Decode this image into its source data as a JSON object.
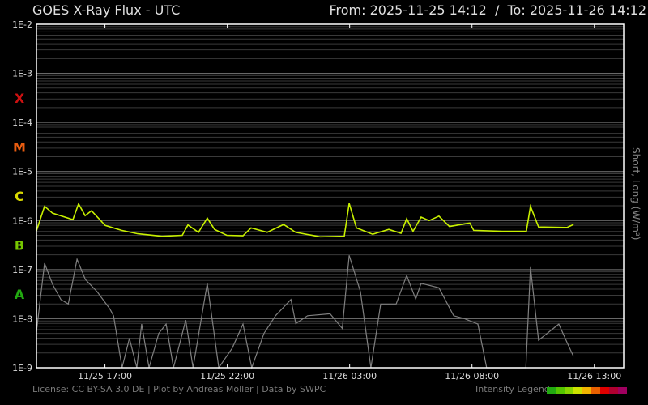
{
  "header": {
    "title": "GOES X-Ray Flux - UTC",
    "range": "From: 2025-11-25 14:12  /  To: 2025-11-26 14:12"
  },
  "footer": {
    "license": "License: CC BY-SA 3.0 DE | Plot by Andreas Möller | Data by SWPC",
    "legend_label": "Intensity Legend",
    "legend_colors": [
      "#22aa11",
      "#55c500",
      "#88d400",
      "#cce200",
      "#f0b400",
      "#e86000",
      "#e00000",
      "#b00030",
      "#a00060"
    ]
  },
  "chart_data": {
    "type": "line",
    "title": "GOES X-Ray Flux - UTC",
    "ylabel": "Short, Long (W/m²)",
    "yscale": "log",
    "ylim_log10": [
      -9,
      -2
    ],
    "xlim_hours_from_start": [
      0,
      24
    ],
    "y_tick_labels": [
      "1E-2",
      "1E-3",
      "1E-4",
      "1E-5",
      "1E-6",
      "1E-7",
      "1E-8",
      "1E-9"
    ],
    "y_tick_values_log10": [
      -2,
      -3,
      -4,
      -5,
      -6,
      -7,
      -8,
      -9
    ],
    "flare_classes": [
      {
        "label": "X",
        "color": "#cc1111",
        "log10": -3.5
      },
      {
        "label": "M",
        "color": "#e85c10",
        "log10": -4.5
      },
      {
        "label": "C",
        "color": "#d8d800",
        "log10": -5.5
      },
      {
        "label": "B",
        "color": "#77c800",
        "log10": -6.5
      },
      {
        "label": "A",
        "color": "#22aa11",
        "log10": -7.5
      }
    ],
    "x_tick_labels": [
      "11/25 17:00",
      "11/25 22:00",
      "11/26 03:00",
      "11/26 08:00",
      "11/26 13:00"
    ],
    "x_tick_hours": [
      2.8,
      7.8,
      12.8,
      17.8,
      22.8
    ],
    "series": [
      {
        "name": "Long",
        "color": "#c8f000",
        "points": [
          [
            0,
            -6.21
          ],
          [
            0.33,
            -5.71
          ],
          [
            0.66,
            -5.85
          ],
          [
            1.49,
            -5.98
          ],
          [
            1.72,
            -5.66
          ],
          [
            1.99,
            -5.9
          ],
          [
            2.25,
            -5.8
          ],
          [
            2.81,
            -6.1
          ],
          [
            3.48,
            -6.2
          ],
          [
            4.14,
            -6.27
          ],
          [
            5.13,
            -6.32
          ],
          [
            5.96,
            -6.3
          ],
          [
            6.19,
            -6.09
          ],
          [
            6.62,
            -6.24
          ],
          [
            6.98,
            -5.95
          ],
          [
            7.28,
            -6.18
          ],
          [
            7.78,
            -6.3
          ],
          [
            8.44,
            -6.31
          ],
          [
            8.77,
            -6.15
          ],
          [
            9.43,
            -6.24
          ],
          [
            10.1,
            -6.08
          ],
          [
            10.59,
            -6.24
          ],
          [
            11.59,
            -6.33
          ],
          [
            12.58,
            -6.32
          ],
          [
            12.78,
            -5.65
          ],
          [
            13.08,
            -6.15
          ],
          [
            13.74,
            -6.28
          ],
          [
            14.4,
            -6.18
          ],
          [
            14.9,
            -6.26
          ],
          [
            15.13,
            -5.96
          ],
          [
            15.39,
            -6.22
          ],
          [
            15.72,
            -5.93
          ],
          [
            16.05,
            -6.0
          ],
          [
            16.45,
            -5.91
          ],
          [
            16.88,
            -6.12
          ],
          [
            17.71,
            -6.05
          ],
          [
            17.87,
            -6.2
          ],
          [
            19.03,
            -6.22
          ],
          [
            20.02,
            -6.22
          ],
          [
            20.19,
            -5.71
          ],
          [
            20.52,
            -6.13
          ],
          [
            21.68,
            -6.14
          ],
          [
            21.95,
            -6.08
          ]
        ]
      },
      {
        "name": "Short",
        "color": "#808080",
        "points": [
          [
            0,
            -8.27
          ],
          [
            0.33,
            -6.87
          ],
          [
            0.66,
            -7.3
          ],
          [
            1.0,
            -7.61
          ],
          [
            1.3,
            -7.7
          ],
          [
            1.66,
            -6.79
          ],
          [
            2.0,
            -7.2
          ],
          [
            2.48,
            -7.45
          ],
          [
            3.0,
            -7.8
          ],
          [
            3.15,
            -7.94
          ],
          [
            3.5,
            -9
          ],
          [
            3.8,
            -8.4
          ],
          [
            4.1,
            -9
          ],
          [
            4.3,
            -8.11
          ],
          [
            4.6,
            -9
          ],
          [
            5.0,
            -8.3
          ],
          [
            5.3,
            -8.11
          ],
          [
            5.6,
            -9
          ],
          [
            6.1,
            -8.03
          ],
          [
            6.4,
            -9
          ],
          [
            6.98,
            -7.28
          ],
          [
            7.45,
            -9
          ],
          [
            8.0,
            -8.6
          ],
          [
            8.44,
            -8.11
          ],
          [
            8.8,
            -9
          ],
          [
            9.3,
            -8.3
          ],
          [
            9.77,
            -7.94
          ],
          [
            10.4,
            -7.61
          ],
          [
            10.6,
            -8.1
          ],
          [
            11.08,
            -7.94
          ],
          [
            12.0,
            -7.9
          ],
          [
            12.5,
            -8.2
          ],
          [
            12.78,
            -6.71
          ],
          [
            13.24,
            -7.45
          ],
          [
            13.67,
            -9
          ],
          [
            14.07,
            -7.7
          ],
          [
            14.7,
            -7.7
          ],
          [
            15.13,
            -7.12
          ],
          [
            15.5,
            -7.6
          ],
          [
            15.72,
            -7.28
          ],
          [
            16.45,
            -7.37
          ],
          [
            17.05,
            -7.94
          ],
          [
            17.5,
            -8.0
          ],
          [
            18.04,
            -8.11
          ],
          [
            18.4,
            -9
          ],
          [
            19.0,
            -9
          ],
          [
            20.0,
            -9
          ],
          [
            20.19,
            -6.95
          ],
          [
            20.52,
            -8.44
          ],
          [
            21.35,
            -8.11
          ],
          [
            21.7,
            -8.5
          ],
          [
            21.95,
            -8.77
          ]
        ]
      }
    ]
  }
}
